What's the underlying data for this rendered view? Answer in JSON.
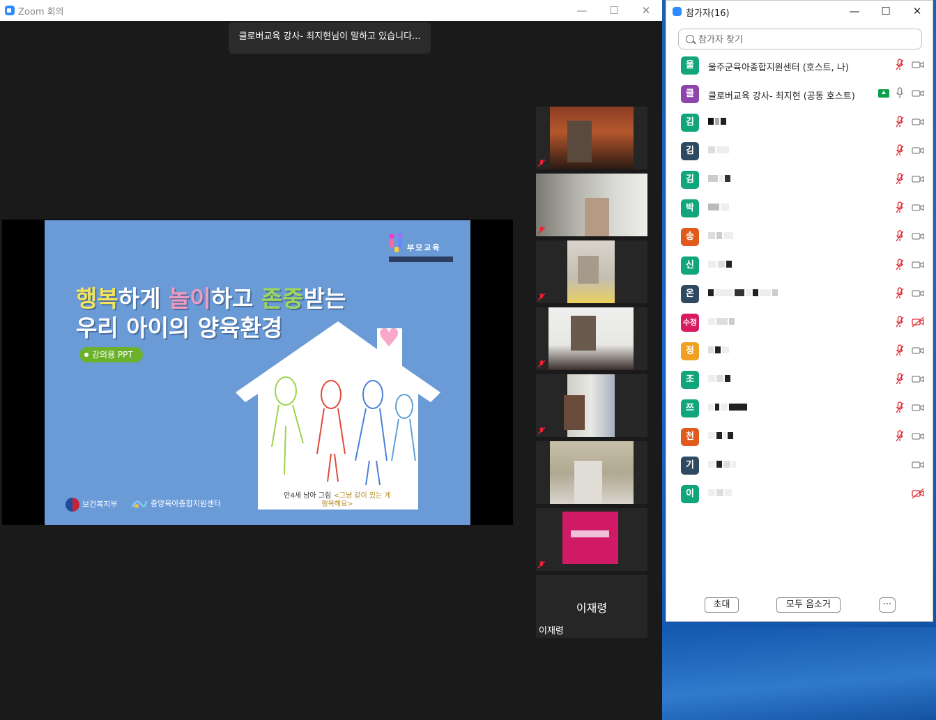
{
  "zoom_window": {
    "title": "Zoom 회의",
    "speaker_toast": "클로버교육 강사- 최지현님이 말하고 있습니다..."
  },
  "slide": {
    "title_line1_parts": [
      "행복",
      "하게 ",
      "놀이",
      "하고 ",
      "존중",
      "받는"
    ],
    "title_line2": "우리 아이의 양육환경",
    "badge": "강의용 PPT",
    "logo_text": "부모교육",
    "caption_prefix": "만4세 남아 그림 ",
    "caption_highlight": "<그냥 같이 있는 게 행복해요>",
    "footer_ministry": "보건복지부",
    "footer_center": "중앙육아종합지원센터"
  },
  "thumbnails": {
    "last_center_name": "이재령",
    "last_label": "이재령"
  },
  "participants_window": {
    "title": "참가자(16)",
    "search_placeholder": "참가자 찾기",
    "participants": [
      {
        "initial": "울",
        "name": "울주군육아종합지원센터 (호스트, 나)",
        "color": "#11a57b"
      },
      {
        "initial": "클",
        "name": "클로버교육 강사- 최지현 (공동 호스트)",
        "color": "#8e44ad"
      },
      {
        "initial": "김",
        "name": "",
        "color": "#11a57b"
      },
      {
        "initial": "김",
        "name": "",
        "color": "#2e4a62"
      },
      {
        "initial": "김",
        "name": "",
        "color": "#11a57b"
      },
      {
        "initial": "박",
        "name": "",
        "color": "#11a57b"
      },
      {
        "initial": "송",
        "name": "",
        "color": "#e05a1c"
      },
      {
        "initial": "신",
        "name": "",
        "color": "#11a57b"
      },
      {
        "initial": "온",
        "name": "",
        "color": "#2e4a62"
      },
      {
        "initial": "수정",
        "name": "",
        "color": "#d81b60"
      },
      {
        "initial": "정",
        "name": "",
        "color": "#f0a020"
      },
      {
        "initial": "조",
        "name": "",
        "color": "#11a57b"
      },
      {
        "initial": "쯔",
        "name": "",
        "color": "#11a57b"
      },
      {
        "initial": "천",
        "name": "",
        "color": "#e05a1c"
      },
      {
        "initial": "기",
        "name": "",
        "color": "#2e4a62"
      },
      {
        "initial": "이",
        "name": "",
        "color": "#11a57b"
      }
    ],
    "invite_label": "초대",
    "mute_all_label": "모두 음소거",
    "more_label": "···"
  }
}
